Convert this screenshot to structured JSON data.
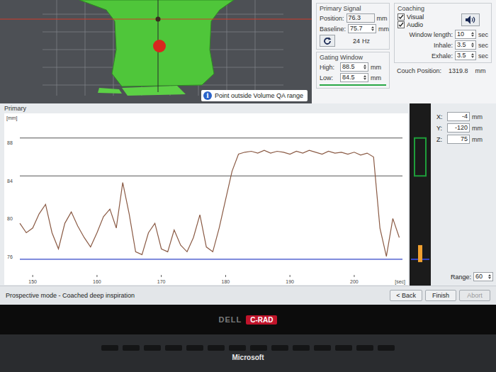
{
  "view3d": {
    "info_icon": "i",
    "message": "Point outside Volume QA range"
  },
  "primary_signal": {
    "title": "Primary Signal",
    "position": {
      "label": "Position:",
      "value": "76.3",
      "unit": "mm"
    },
    "baseline": {
      "label": "Baseline:",
      "value": "75.7",
      "unit": "mm"
    },
    "rate": {
      "value": "24",
      "unit": "Hz"
    }
  },
  "gating_window": {
    "title": "Gating Window",
    "high": {
      "label": "High:",
      "value": "88.5",
      "unit": "mm"
    },
    "low": {
      "label": "Low:",
      "value": "84.5",
      "unit": "mm"
    }
  },
  "coaching": {
    "title": "Coaching",
    "options": [
      {
        "label": "Visual",
        "checked": true
      },
      {
        "label": "Audio",
        "checked": true
      }
    ],
    "settings": [
      {
        "label": "Window length:",
        "value": "10",
        "unit": "sec"
      },
      {
        "label": "Inhale:",
        "value": "3.5",
        "unit": "sec"
      },
      {
        "label": "Exhale:",
        "value": "3.5",
        "unit": "sec"
      }
    ]
  },
  "couch_position": {
    "label": "Couch Position:",
    "value": "1319.8",
    "unit": "mm"
  },
  "chart": {
    "title": "Primary",
    "y_unit": "[mm]",
    "x_unit": "[sec]",
    "y_ticks": [
      "88",
      "84",
      "80",
      "76"
    ],
    "x_ticks": [
      "150",
      "160",
      "170",
      "180",
      "190",
      "200"
    ],
    "t_start": 148,
    "t_step": 1,
    "values": [
      79.5,
      78.5,
      79.0,
      80.5,
      81.5,
      78.5,
      76.8,
      79.5,
      80.7,
      79.2,
      78.0,
      77.0,
      78.5,
      80.2,
      81.0,
      79.0,
      83.8,
      80.5,
      76.5,
      76.2,
      78.5,
      79.5,
      76.8,
      76.5,
      78.8,
      77.2,
      76.5,
      78.0,
      80.4,
      77.0,
      76.5,
      79.0,
      82.0,
      85.0,
      86.8,
      87.0,
      87.1,
      86.9,
      87.2,
      86.9,
      87.1,
      87.0,
      86.8,
      87.1,
      86.9,
      87.2,
      87.0,
      86.8,
      87.1,
      86.9,
      87.0,
      86.8,
      87.0,
      86.7,
      86.9,
      86.5,
      79.0,
      76.0,
      80.0,
      78.0
    ]
  },
  "position_readout": {
    "coords": [
      {
        "label": "X:",
        "value": "-4",
        "unit": "mm"
      },
      {
        "label": "Y:",
        "value": "-120",
        "unit": "mm"
      },
      {
        "label": "Z:",
        "value": "75",
        "unit": "mm"
      }
    ],
    "range": {
      "label": "Range:",
      "value": "60"
    }
  },
  "status_bar": {
    "mode": "Prospective mode - Coached deep inspiration",
    "buttons": [
      {
        "label": "< Back",
        "disabled": false
      },
      {
        "label": "Finish",
        "disabled": false
      },
      {
        "label": "Abort",
        "disabled": true
      }
    ]
  },
  "monitor": {
    "brand": "DELL",
    "logo": "C-RAD"
  },
  "keyboard": {
    "brand": "Microsoft"
  }
}
